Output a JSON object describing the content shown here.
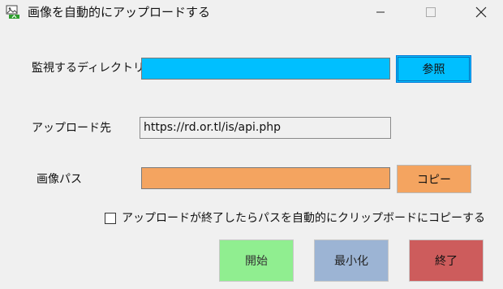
{
  "window": {
    "title": "画像を自動的にアップロードする",
    "icon": "image-upload-icon"
  },
  "controls": {
    "minimize_icon": "minimize-icon",
    "maximize_icon": "maximize-icon",
    "close_icon": "close-icon"
  },
  "form": {
    "watch_dir": {
      "label": "監視するディレクトリ",
      "value": "",
      "color": "#00bfff",
      "browse_button": "参照"
    },
    "upload_url": {
      "label": "アップロード先",
      "value": "https://rd.or.tl/is/api.php"
    },
    "image_path": {
      "label": "画像パス",
      "value": "",
      "color": "#f4a460",
      "copy_button": "コピー"
    },
    "auto_copy": {
      "label": "アップロードが終了したらパスを自動的にクリップボードにコピーする",
      "checked": false
    }
  },
  "actions": {
    "start": "開始",
    "minimize": "最小化",
    "exit": "終了"
  },
  "colors": {
    "start": "#90ee90",
    "minimize": "#9cb4d4",
    "exit": "#cd5c5c"
  }
}
